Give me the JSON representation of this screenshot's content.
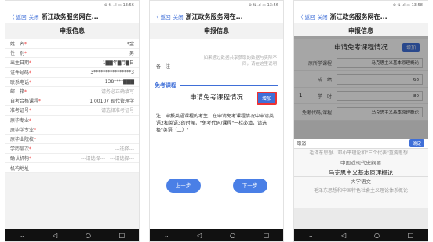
{
  "status": {
    "text": "⊕ ⇅ .ıl ▭ 13:56",
    "text3": "⊕ ⇅ .ıl ▭ 13:58"
  },
  "nav": {
    "back": "〈 返回",
    "close": "关闭",
    "title": "浙江政务服务网在..."
  },
  "page_title": "申报信息",
  "screen1": {
    "rows": [
      {
        "label": "姓　名",
        "star": "*",
        "value": "*金",
        "ph": false
      },
      {
        "label": "性　别",
        "star": "*",
        "value": "男",
        "ph": false
      },
      {
        "label": "出生日期",
        "star": "*",
        "value": "1▇▇年▇月▇日",
        "ph": false
      },
      {
        "label": "证件号码",
        "star": "*",
        "value": "3****************3",
        "ph": false
      },
      {
        "label": "联系电话",
        "star": "*",
        "value": "138****▇▇▇",
        "ph": false
      },
      {
        "label": "邮　箱",
        "star": "*",
        "value": "请务必正确填写",
        "ph": true
      },
      {
        "label": "自考合格课程",
        "star": "*",
        "value": "1 00107 现代管理学",
        "ph": false
      },
      {
        "label": "准考证号",
        "star": "*",
        "value": "请选择准考证号",
        "ph": true
      },
      {
        "label": "原毕专业",
        "star": "*",
        "value": "",
        "ph": false
      },
      {
        "label": "原毕学专业",
        "star": "*",
        "value": "",
        "ph": false
      },
      {
        "label": "原毕业院校",
        "star": "*",
        "value": "",
        "ph": false
      },
      {
        "label": "学历层次",
        "star": "*",
        "value": "---选择---",
        "ph": true
      },
      {
        "label": "确认机构",
        "star": "*",
        "value": "---请选择---　---请选择---",
        "ph": true
      },
      {
        "label": "机构地址",
        "star": "",
        "value": "",
        "ph": false
      }
    ]
  },
  "screen2": {
    "remark_label": "备　注",
    "remark_placeholder": "如果通过数据共享获取的数据与实际不同，请在这里说明",
    "exempt_title": "免考课程",
    "apply_title": "申请免考课程情况",
    "add_label": "增加",
    "note": "注：申报英语课程的考生，在申请免考课程情况中申请英语2和英语3的时候，\"免考代码/课程\"一栏必填，请选择\"英语（二）\"",
    "prev": "上一步",
    "next": "下一步"
  },
  "screen3": {
    "apply_title": "申请免考课程情况",
    "add_label": "增加",
    "fields": [
      {
        "label": "原所学课程",
        "value": "马克思主义基本原理概论",
        "idx": ""
      },
      {
        "label": "成　绩",
        "value": "68",
        "idx": ""
      },
      {
        "label": "学　时",
        "value": "80",
        "idx": "1"
      },
      {
        "label": "免考代码/课程",
        "value": "马克思主义基本原理概论",
        "idx": ""
      }
    ],
    "picker": {
      "cancel": "取消",
      "confirm": "确定",
      "options": [
        {
          "text": "毛泽东思想、邓小平理论和\"三个代表\"重要思想...",
          "cls": ""
        },
        {
          "text": "中国近现代史纲要",
          "cls": "near"
        },
        {
          "text": "马克思主义基本原理概论",
          "cls": "sel"
        },
        {
          "text": "大学语文",
          "cls": "near"
        },
        {
          "text": "毛泽东思想和中国特色社会主义理论体系概论",
          "cls": ""
        }
      ]
    }
  },
  "navkeys": {
    "back": "◁",
    "home": "○",
    "recent": "□",
    "menu": "⌄"
  }
}
